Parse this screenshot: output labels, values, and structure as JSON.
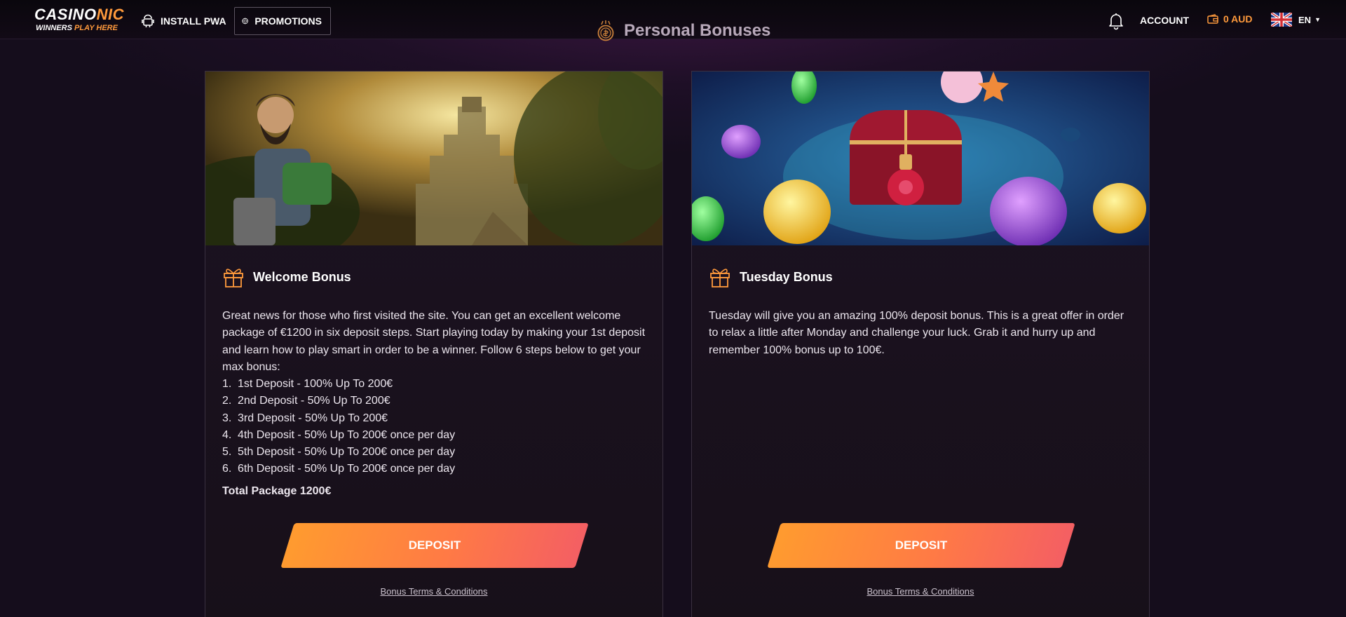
{
  "header": {
    "logo": {
      "brand_white": "CASINO",
      "brand_orange": "NIC",
      "tagline_white": "WINNERS",
      "tagline_orange": "PLAY HERE"
    },
    "install_pwa": "INSTALL PWA",
    "promotions": "PROMOTIONS",
    "page_title": "Personal Bonuses",
    "account": "ACCOUNT",
    "balance": "0 AUD",
    "language": "EN"
  },
  "cards": [
    {
      "title": "Welcome Bonus",
      "description": "Great news for those who first visited the site. You can get an excellent welcome package of €1200 in six deposit steps. Start playing today by making your 1st deposit and learn how to play smart in order to be a winner. Follow 6 steps below to get your max bonus:",
      "steps": [
        "1st Deposit - 100% Up To 200€",
        "2nd Deposit - 50% Up To 200€",
        "3rd Deposit - 50% Up To 200€",
        "4th Deposit - 50% Up To 200€ once per day",
        "5th Deposit - 50% Up To 200€ once per day",
        "6th Deposit - 50% Up To 200€ once per day"
      ],
      "total": "Total Package 1200€",
      "button": "DEPOSIT",
      "terms": "Bonus Terms & Conditions"
    },
    {
      "title": "Tuesday Bonus",
      "description": "Tuesday will give you an amazing 100% deposit bonus. This is a great offer in order to relax a little after Monday and challenge your luck. Grab it and hurry up and remember 100% bonus up to 100€.",
      "button": "DEPOSIT",
      "terms": "Bonus Terms & Conditions"
    }
  ],
  "colors": {
    "accent": "#ff9a3c",
    "button_start": "#ff9b2f",
    "button_end": "#f45f63",
    "background": "#150d1c"
  },
  "icons": [
    "android-icon",
    "promo-chip-icon",
    "coin-icon",
    "bell-icon",
    "wallet-icon",
    "uk-flag-icon",
    "gift-icon"
  ]
}
